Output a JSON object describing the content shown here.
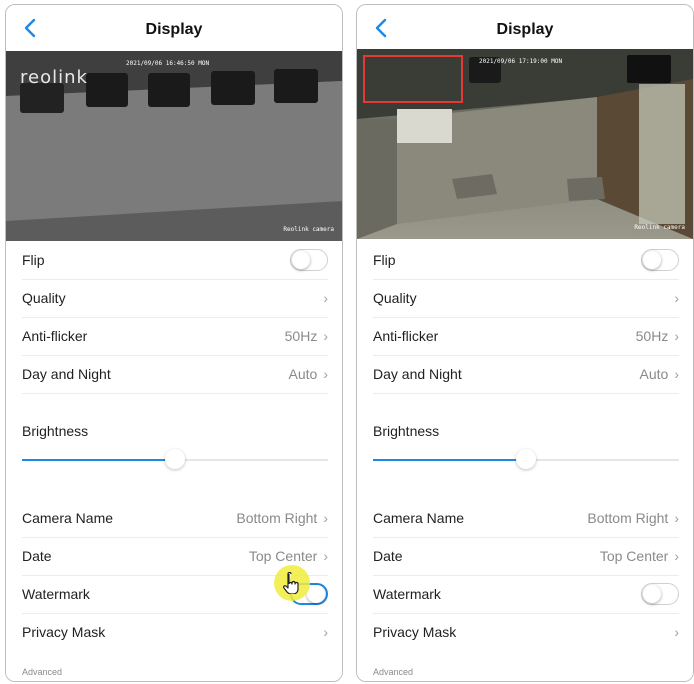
{
  "screens": [
    {
      "id": "left",
      "title": "Display",
      "video": {
        "timestamp": "2021/09/06 16:46:50 MON",
        "watermark_text": "Reolink camera",
        "logo": "reolink",
        "privacy_mask_box_visible": false
      },
      "settings": {
        "flip": {
          "label": "Flip",
          "on": false
        },
        "quality": {
          "label": "Quality"
        },
        "anti_flicker": {
          "label": "Anti-flicker",
          "value": "50Hz"
        },
        "day_night": {
          "label": "Day and Night",
          "value": "Auto"
        },
        "brightness": {
          "label": "Brightness",
          "level_fraction": 0.5
        },
        "camera_name": {
          "label": "Camera Name",
          "value": "Bottom Right"
        },
        "date": {
          "label": "Date",
          "value": "Top Center"
        },
        "watermark": {
          "label": "Watermark",
          "on": true
        },
        "privacy_mask": {
          "label": "Privacy Mask"
        },
        "advanced": "Advanced"
      },
      "tap_indicator_visible": true
    },
    {
      "id": "right",
      "title": "Display",
      "video": {
        "timestamp": "2021/09/06 17:19:00 MON",
        "watermark_text": "Reolink camera",
        "logo": "",
        "privacy_mask_box_visible": true
      },
      "settings": {
        "flip": {
          "label": "Flip",
          "on": false
        },
        "quality": {
          "label": "Quality"
        },
        "anti_flicker": {
          "label": "Anti-flicker",
          "value": "50Hz"
        },
        "day_night": {
          "label": "Day and Night",
          "value": "Auto"
        },
        "brightness": {
          "label": "Brightness",
          "level_fraction": 0.5
        },
        "camera_name": {
          "label": "Camera Name",
          "value": "Bottom Right"
        },
        "date": {
          "label": "Date",
          "value": "Top Center"
        },
        "watermark": {
          "label": "Watermark",
          "on": false
        },
        "privacy_mask": {
          "label": "Privacy Mask"
        },
        "advanced": "Advanced"
      },
      "tap_indicator_visible": false
    }
  ],
  "colors": {
    "accent": "#1e88e5",
    "privacy_mask_box": "#e53935",
    "tap_indicator": "#f0ec3c",
    "value_text": "#8a8a8a"
  },
  "icons": {
    "back": "chevron-left-icon",
    "row_arrow": "chevron-right-icon",
    "pointer": "hand-pointer-icon"
  }
}
